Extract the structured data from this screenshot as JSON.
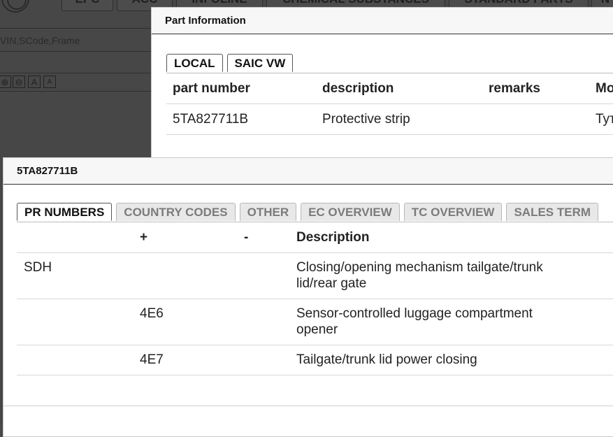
{
  "background_app": {
    "tabs": [
      {
        "label": "EPC"
      },
      {
        "label": "ACC"
      },
      {
        "label": "INFOLINE"
      },
      {
        "label": "CHEMICAL SUBSTANCES"
      },
      {
        "label": "STANDARD PARTS"
      },
      {
        "label": "N"
      }
    ],
    "search": {
      "placeholder": "VIN,SCode,Frame"
    },
    "tools": [
      {
        "icon": "zoom-in-icon",
        "glyph": "⊕"
      },
      {
        "icon": "zoom-out-icon",
        "glyph": "⊖"
      },
      {
        "icon": "font-increase-icon",
        "glyph": "A"
      },
      {
        "icon": "font-decrease-icon",
        "glyph": "A"
      }
    ]
  },
  "part_info": {
    "title": "Part Information",
    "tabs": [
      {
        "label": "LOCAL"
      },
      {
        "label": "SAIC VW"
      }
    ],
    "columns": [
      "part number",
      "description",
      "remarks",
      "Mo"
    ],
    "rows": [
      {
        "part_number": "5TA827711B",
        "description": "Protective strip",
        "remarks": "",
        "model": "Тут"
      }
    ]
  },
  "pr_dialog": {
    "title": "5TA827711B",
    "tabs": [
      {
        "label": "PR NUMBERS"
      },
      {
        "label": "COUNTRY CODES"
      },
      {
        "label": "OTHER"
      },
      {
        "label": "EC OVERVIEW"
      },
      {
        "label": "TC OVERVIEW"
      },
      {
        "label": "SALES TERM"
      }
    ],
    "columns": {
      "family": "",
      "plus": "+",
      "minus": "-",
      "description": "Description"
    },
    "rows": [
      {
        "family": "SDH",
        "plus": "",
        "minus": "",
        "description": "Closing/opening mechanism tailgate/trunk lid/rear gate"
      },
      {
        "family": "",
        "plus": "4E6",
        "minus": "",
        "description": "Sensor-controlled luggage compartment opener"
      },
      {
        "family": "",
        "plus": "4E7",
        "minus": "",
        "description": "Tailgate/trunk lid power closing"
      }
    ]
  }
}
